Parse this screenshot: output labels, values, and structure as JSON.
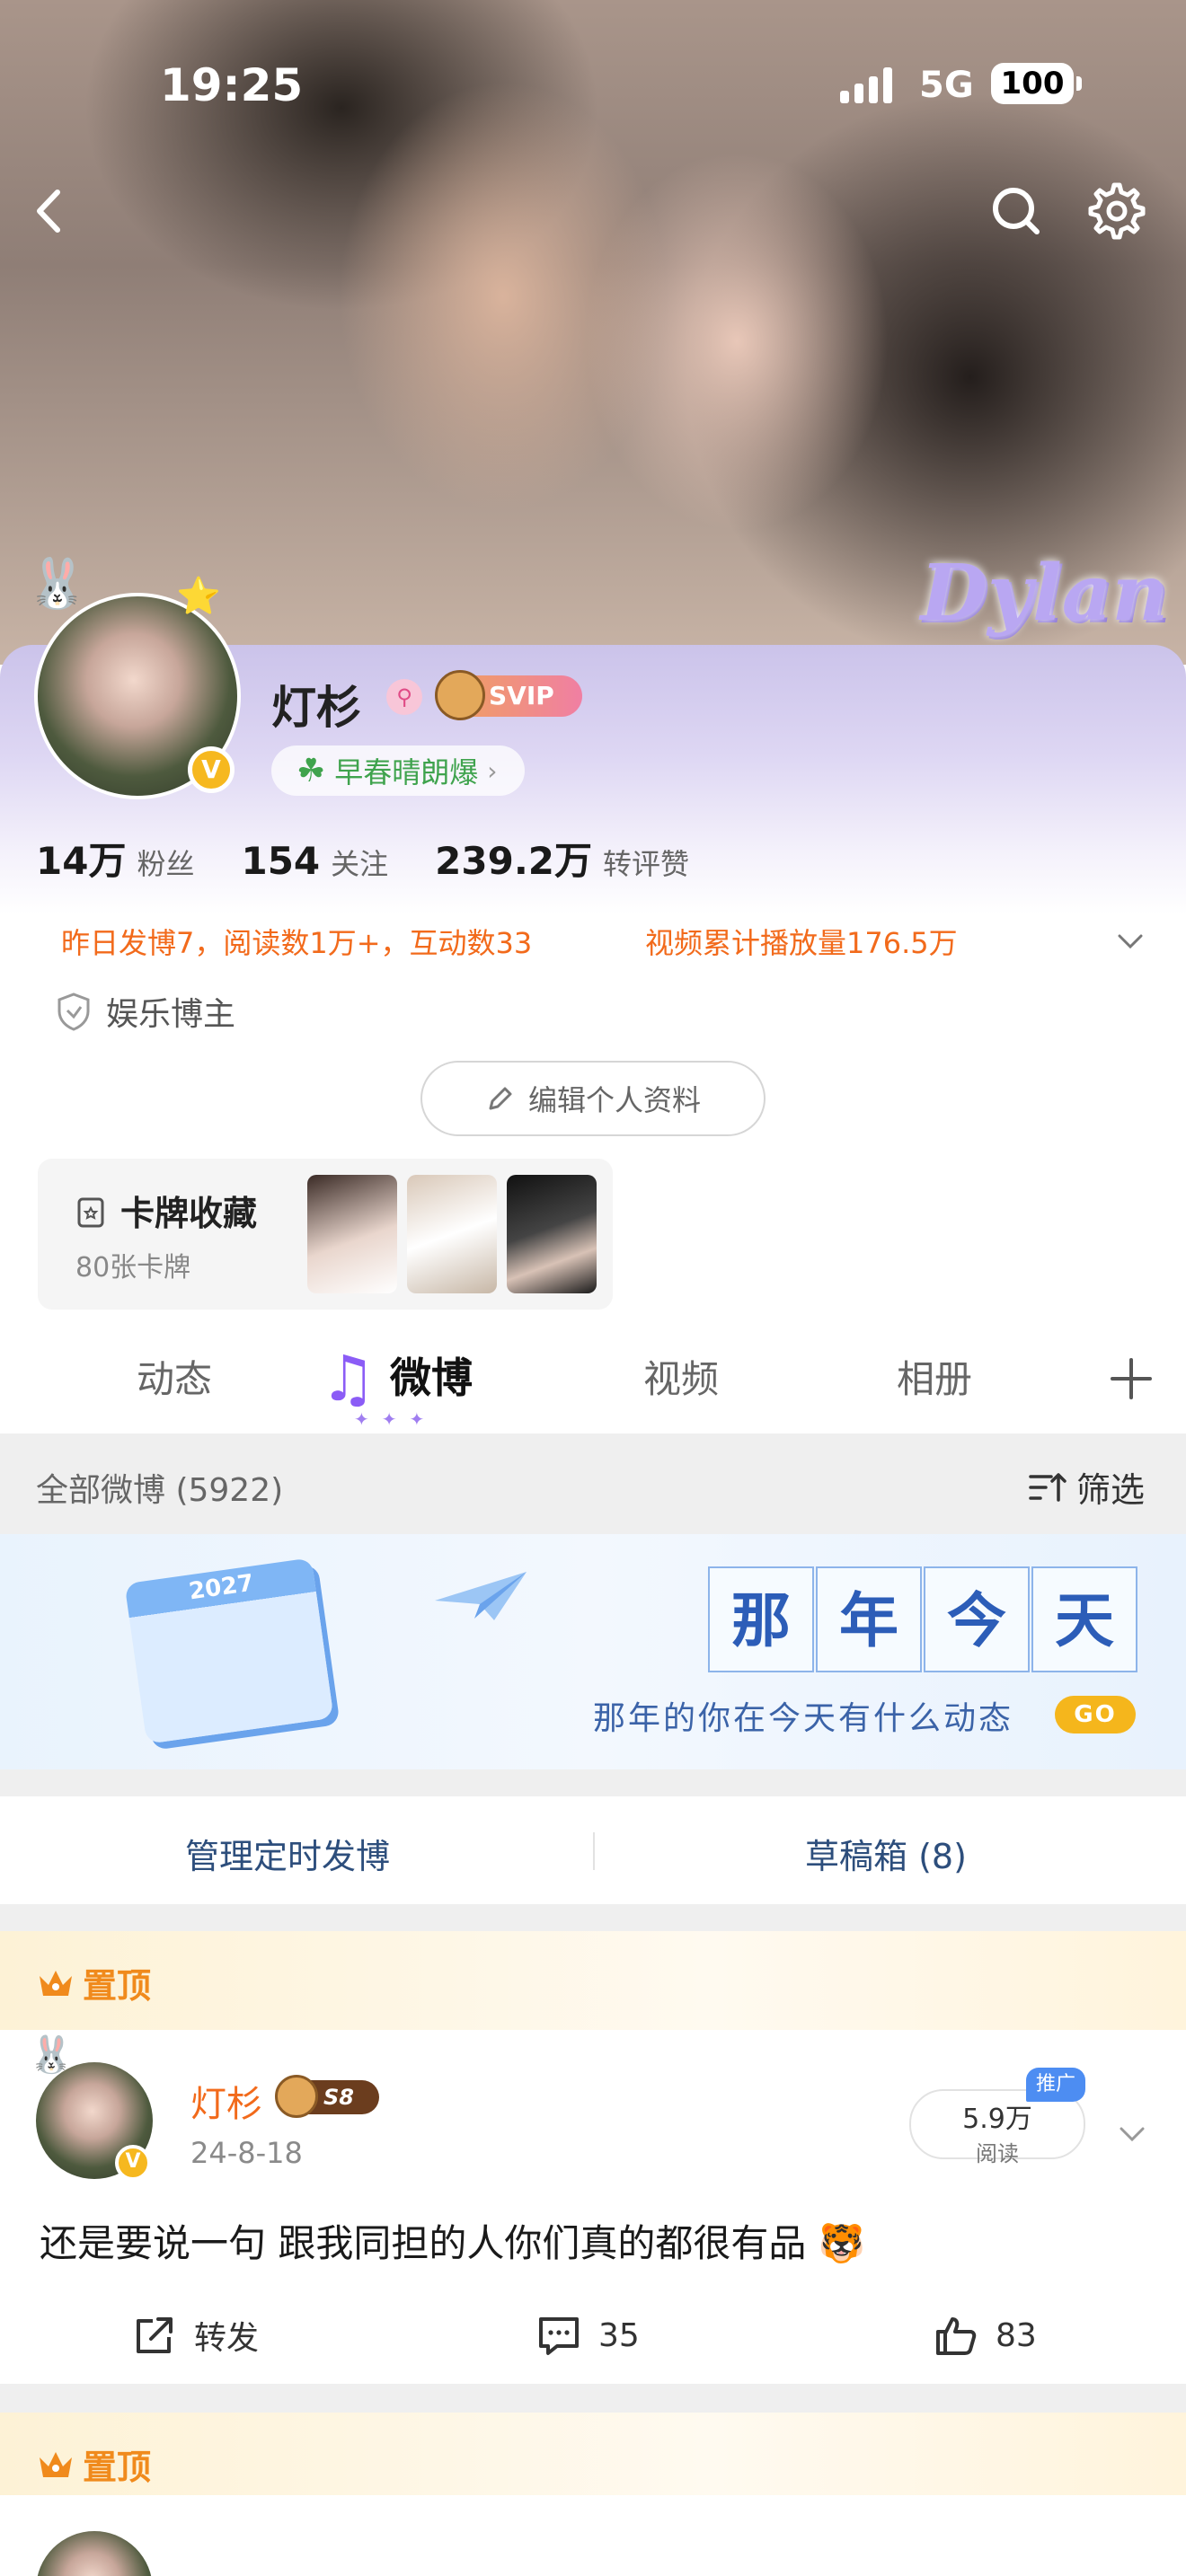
{
  "status": {
    "time": "19:25",
    "network": "5G",
    "battery": "100"
  },
  "cover": {
    "watermark": "Dylan"
  },
  "profile": {
    "name": "灯杉",
    "verified_mark": "V",
    "level_badge": "SVIP",
    "title_chip": "早春晴朗爆",
    "stats": [
      {
        "num": "14万",
        "label": "粉丝"
      },
      {
        "num": "154",
        "label": "关注"
      },
      {
        "num": "239.2万",
        "label": "转评赞"
      }
    ],
    "activity_left": "昨日发博7，阅读数1万+，互动数33",
    "activity_right": "视频累计播放量176.5万",
    "tag": "娱乐博主",
    "edit_button": "编辑个人资料",
    "cards": {
      "title": "卡牌收藏",
      "subtitle": "80张卡牌"
    }
  },
  "tabs": [
    {
      "label": "动态"
    },
    {
      "label": "微博"
    },
    {
      "label": "视频"
    },
    {
      "label": "相册"
    }
  ],
  "feed_header": {
    "label": "全部微博 (5922)",
    "filter": "筛选"
  },
  "memory": {
    "calendar_year": "2027",
    "title_chars": [
      "那",
      "年",
      "今",
      "天"
    ],
    "subtitle": "那年的你在今天有什么动态",
    "go": "GO"
  },
  "manage": {
    "scheduled": "管理定时发博",
    "drafts": "草稿箱 (8)"
  },
  "pinned_label": "置顶",
  "post": {
    "name": "灯杉",
    "level": "S8",
    "date": "24-8-18",
    "reads_num": "5.9万",
    "reads_label": "阅读",
    "promo": "推广",
    "text": "还是要说一句 跟我同担的人你们真的都很有品",
    "repost": "转发",
    "comments": "35",
    "likes": "83"
  },
  "colors": {
    "accent_orange": "#f26a1b",
    "panel_purple": "#cbc3ea",
    "pin_orange": "#f08a1c",
    "link_blue": "#2d4e7c"
  }
}
